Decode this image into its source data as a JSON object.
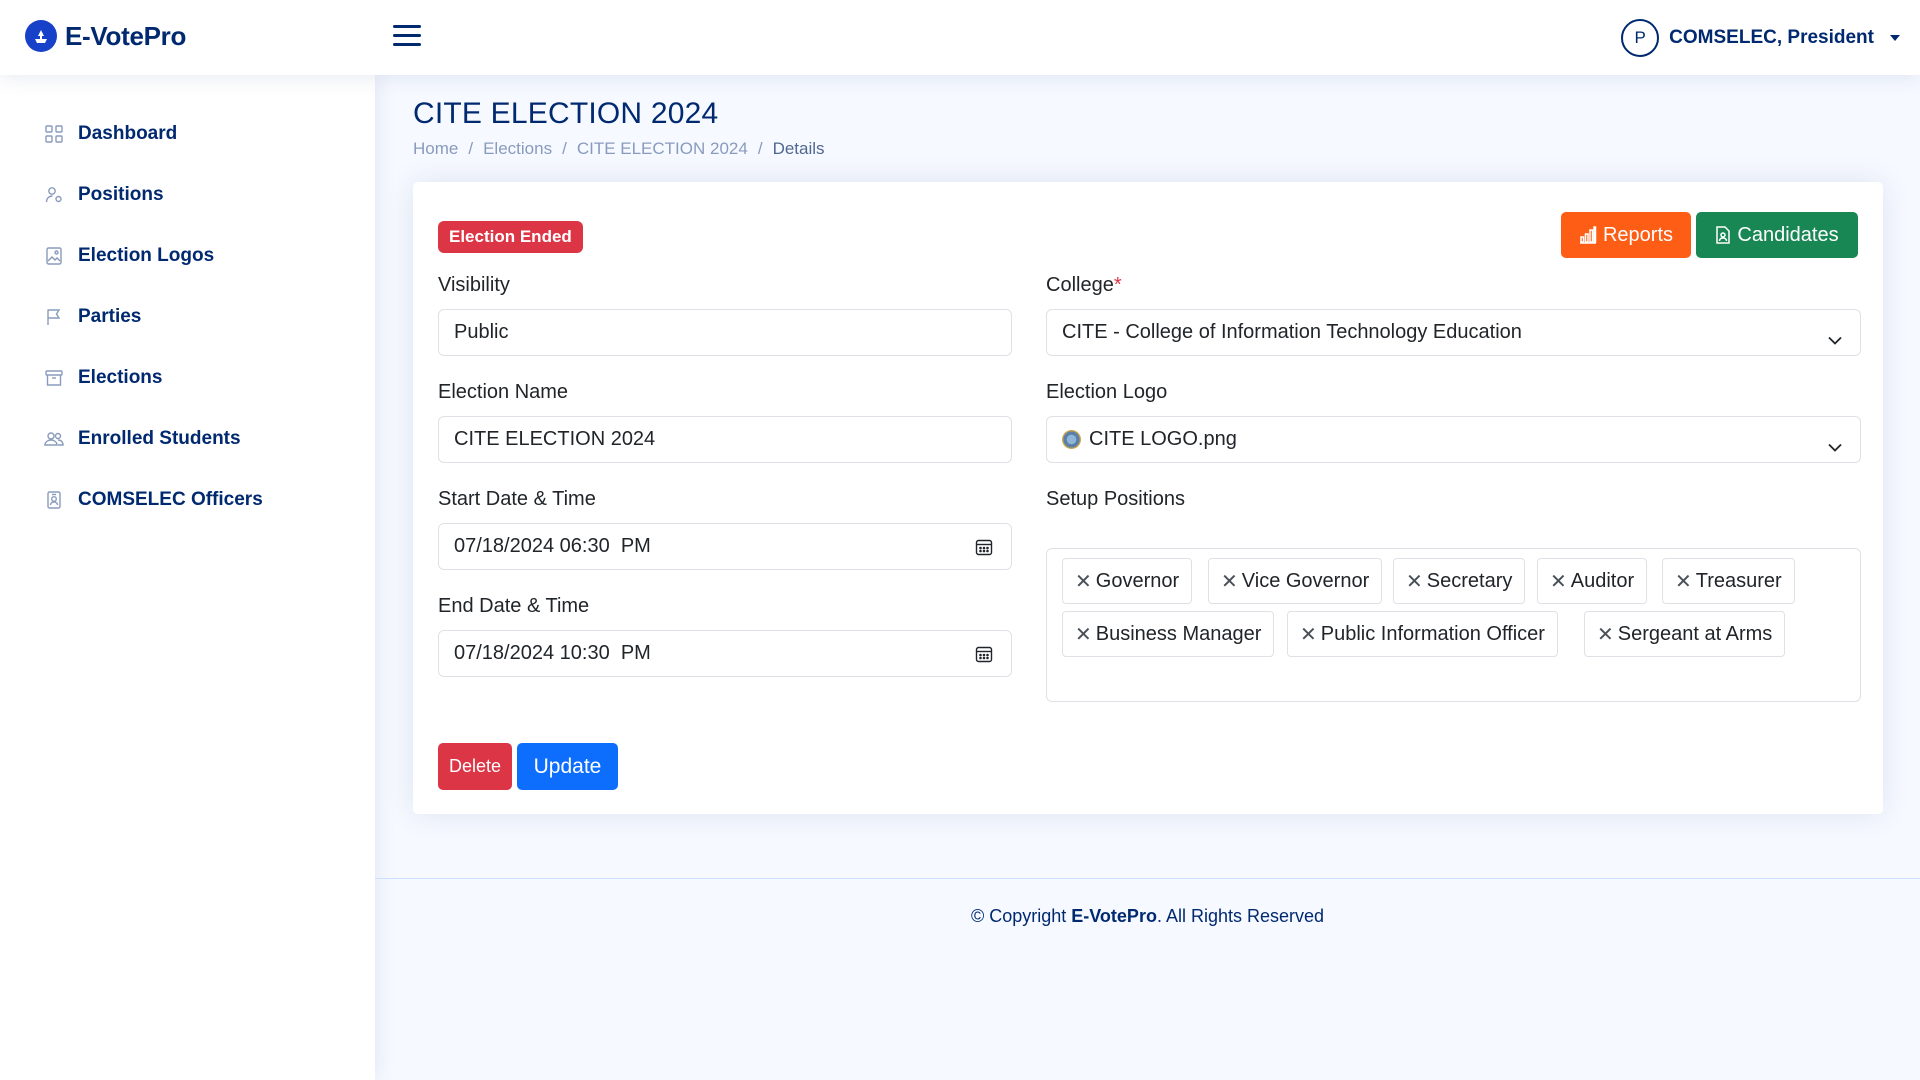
{
  "app": {
    "name": "E-VotePro"
  },
  "header": {
    "profile_initial": "P",
    "profile_name": "COMSELEC, President"
  },
  "sidebar": {
    "items": [
      {
        "label": "Dashboard",
        "icon": "grid-icon"
      },
      {
        "label": "Positions",
        "icon": "person-gear-icon"
      },
      {
        "label": "Election Logos",
        "icon": "image-icon"
      },
      {
        "label": "Parties",
        "icon": "flag-icon"
      },
      {
        "label": "Elections",
        "icon": "archive-icon"
      },
      {
        "label": "Enrolled Students",
        "icon": "people-icon"
      },
      {
        "label": "COMSELEC Officers",
        "icon": "person-badge-icon"
      }
    ]
  },
  "page": {
    "title": "CITE ELECTION 2024",
    "breadcrumb": [
      "Home",
      "Elections",
      "CITE ELECTION 2024",
      "Details"
    ]
  },
  "status_badge": "Election Ended",
  "buttons": {
    "reports": "Reports",
    "candidates": "Candidates",
    "delete": "Delete",
    "update": "Update"
  },
  "form": {
    "visibility": {
      "label": "Visibility",
      "value": "Public"
    },
    "election_name": {
      "label": "Election Name",
      "value": "CITE ELECTION 2024"
    },
    "start": {
      "label": "Start Date & Time",
      "value": "07/18/2024 06:30  PM"
    },
    "end": {
      "label": "End Date & Time",
      "value": "07/18/2024 10:30  PM"
    },
    "college": {
      "label": "College",
      "required_mark": "*",
      "value": "CITE - College of Information Technology Education"
    },
    "election_logo": {
      "label": "Election Logo",
      "value": "CITE LOGO.png"
    },
    "setup_positions": {
      "label": "Setup Positions",
      "tags": [
        "Governor",
        "Vice Governor",
        "Secretary",
        "Auditor",
        "Treasurer",
        "Business Manager",
        "Public Information Officer",
        "Sergeant at Arms"
      ]
    }
  },
  "footer": {
    "prefix": "© Copyright ",
    "brand": "E-VotePro",
    "suffix": ". All Rights Reserved"
  },
  "colors": {
    "brand": "#012970",
    "danger": "#dc3545",
    "primary": "#0d6efd",
    "success": "#198754",
    "orange": "#fd5d14"
  }
}
